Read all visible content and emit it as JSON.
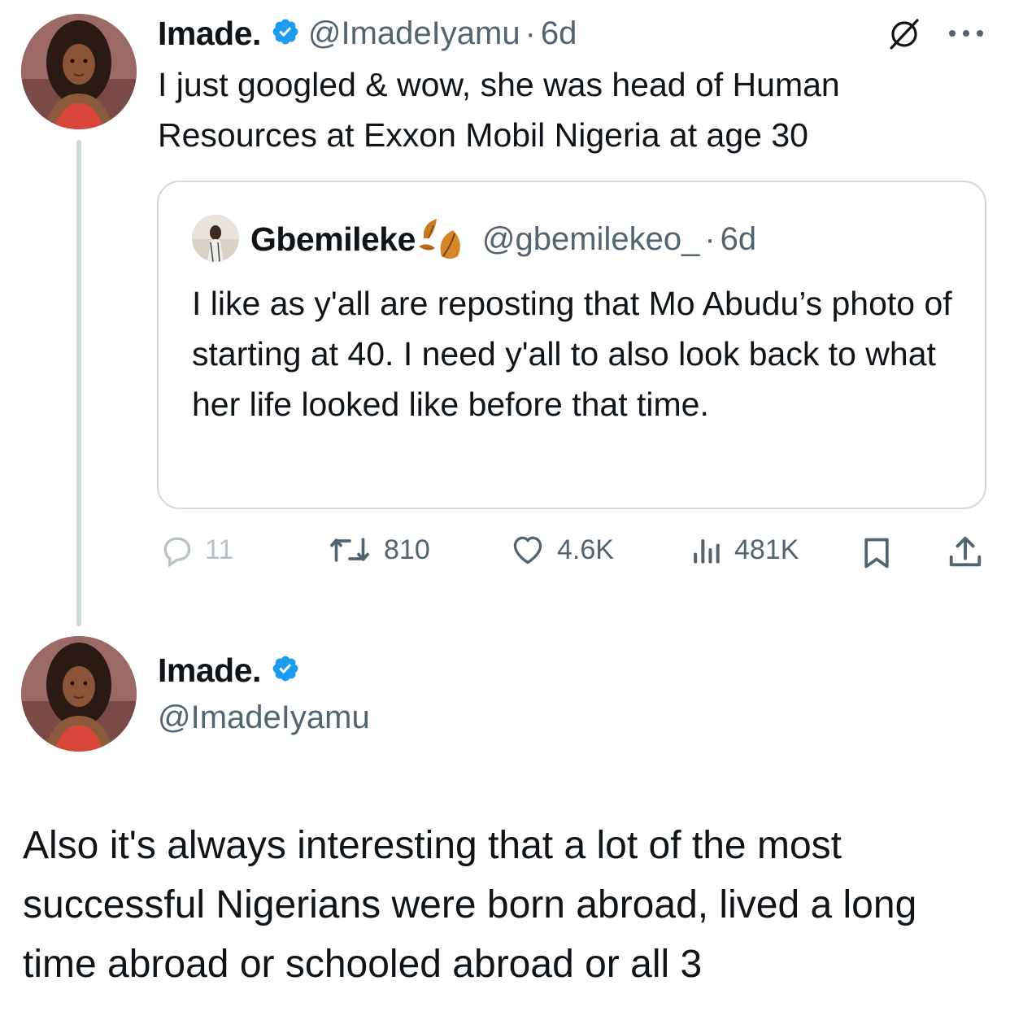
{
  "thread_tweet": {
    "display_name": "Imade.",
    "handle": "@ImadeIyamu",
    "separator": "·",
    "time": "6d",
    "text": "I just googled & wow, she was head of Human Resources at Exxon Mobil Nigeria at age 30",
    "icons": [
      "verified-badge-icon",
      "grok-slash-icon",
      "more-options-icon"
    ],
    "quoted_tweet": {
      "display_name": "Gbemileke",
      "name_emoji_icon": "fallen-leaf-icon",
      "handle": "@gbemilekeo_",
      "separator": "·",
      "time": "6d",
      "text": "I like as y'all are reposting that Mo Abudu’s photo of starting at 40. I need y'all to also look back to what her life looked like before that time."
    },
    "actions": {
      "replies": "11",
      "reposts": "810",
      "likes": "4.6K",
      "views": "481K"
    }
  },
  "main_tweet": {
    "display_name": "Imade.",
    "handle": "@ImadeIyamu",
    "text": "Also it's always interesting that a lot of the most successful Nigerians were born abroad, lived a long time abroad or schooled abroad or all 3"
  },
  "colors": {
    "text_primary": "#0f1419",
    "text_secondary": "#536471",
    "verified_blue": "#1d9bf0",
    "border": "#cfd9de"
  }
}
